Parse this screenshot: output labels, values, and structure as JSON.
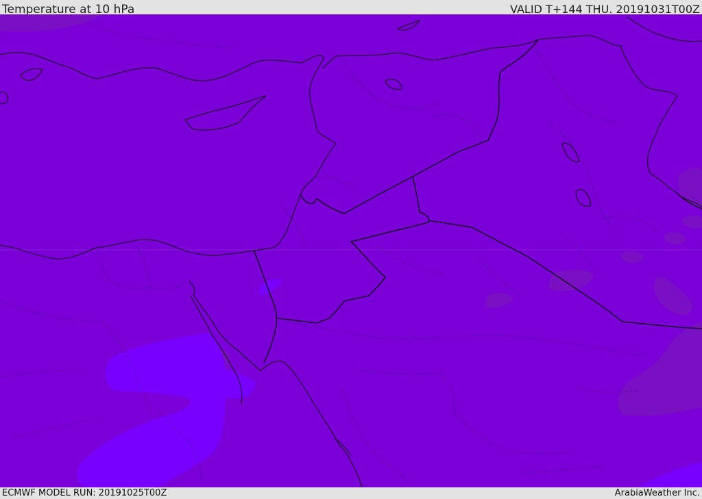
{
  "header": {
    "title": "Temperature at 10 hPa",
    "valid_time": "VALID T+144 THU. 20191031T00Z"
  },
  "footer": {
    "model_run": "ECMWF MODEL RUN: 20191025T00Z",
    "credit": "ArabiaWeather Inc."
  },
  "colors": {
    "field_base": "#7b00d8",
    "field_warmer": "#7800ff",
    "field_cooler": "#7a11c4",
    "coastline": "#111111",
    "borders": "#000000",
    "subdivisions": "#2a0050",
    "header_background": "#e3e3e3"
  }
}
